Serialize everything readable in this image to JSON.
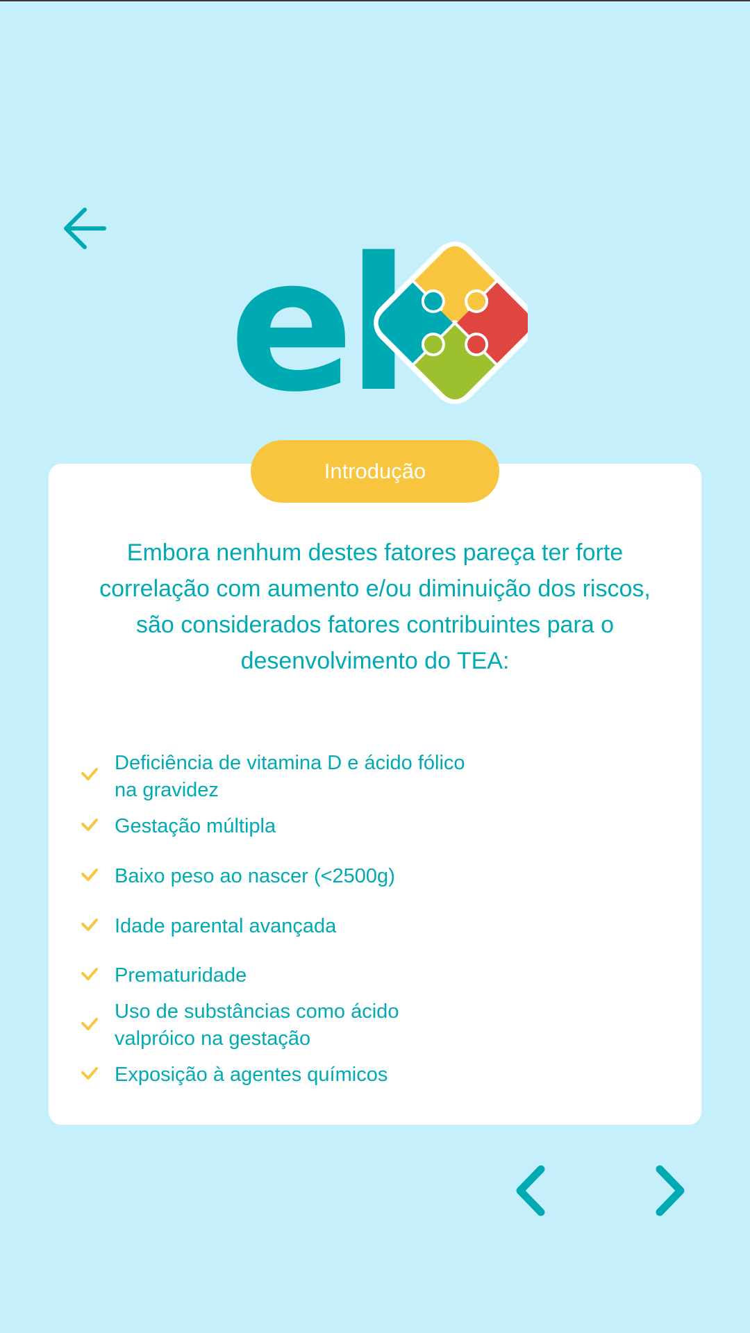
{
  "header": {
    "back_icon": "arrow-left-icon"
  },
  "logo": {
    "text": "el",
    "icon": "puzzle-icon",
    "colors": {
      "text": "#00aab2",
      "yellow": "#f7c53e",
      "red": "#e04540",
      "green": "#9dc02e",
      "teal": "#00aab2"
    }
  },
  "section": {
    "title": "Introdução"
  },
  "intro": {
    "text": "Embora nenhum destes fatores pareça ter forte correlação com aumento e/ou diminuição dos riscos, são considerados fatores contribuintes para o desenvolvimento do TEA:"
  },
  "factors": [
    {
      "label": "Deficiência de vitamina D e ácido fólico\nna gravidez"
    },
    {
      "label": "Gestação múltipla"
    },
    {
      "label": "Baixo peso ao nascer (<2500g)"
    },
    {
      "label": "Idade parental avançada"
    },
    {
      "label": "Prematuridade"
    },
    {
      "label": "Uso de substâncias como ácido\nvalpróico na gestação"
    },
    {
      "label": "Exposição à agentes químicos"
    }
  ],
  "navigation": {
    "prev_icon": "chevron-left-icon",
    "next_icon": "chevron-right-icon"
  },
  "colors": {
    "background": "#c6effc",
    "accent": "#00aab2",
    "pill": "#f7c53e",
    "check": "#f7c53e",
    "card": "#ffffff"
  }
}
